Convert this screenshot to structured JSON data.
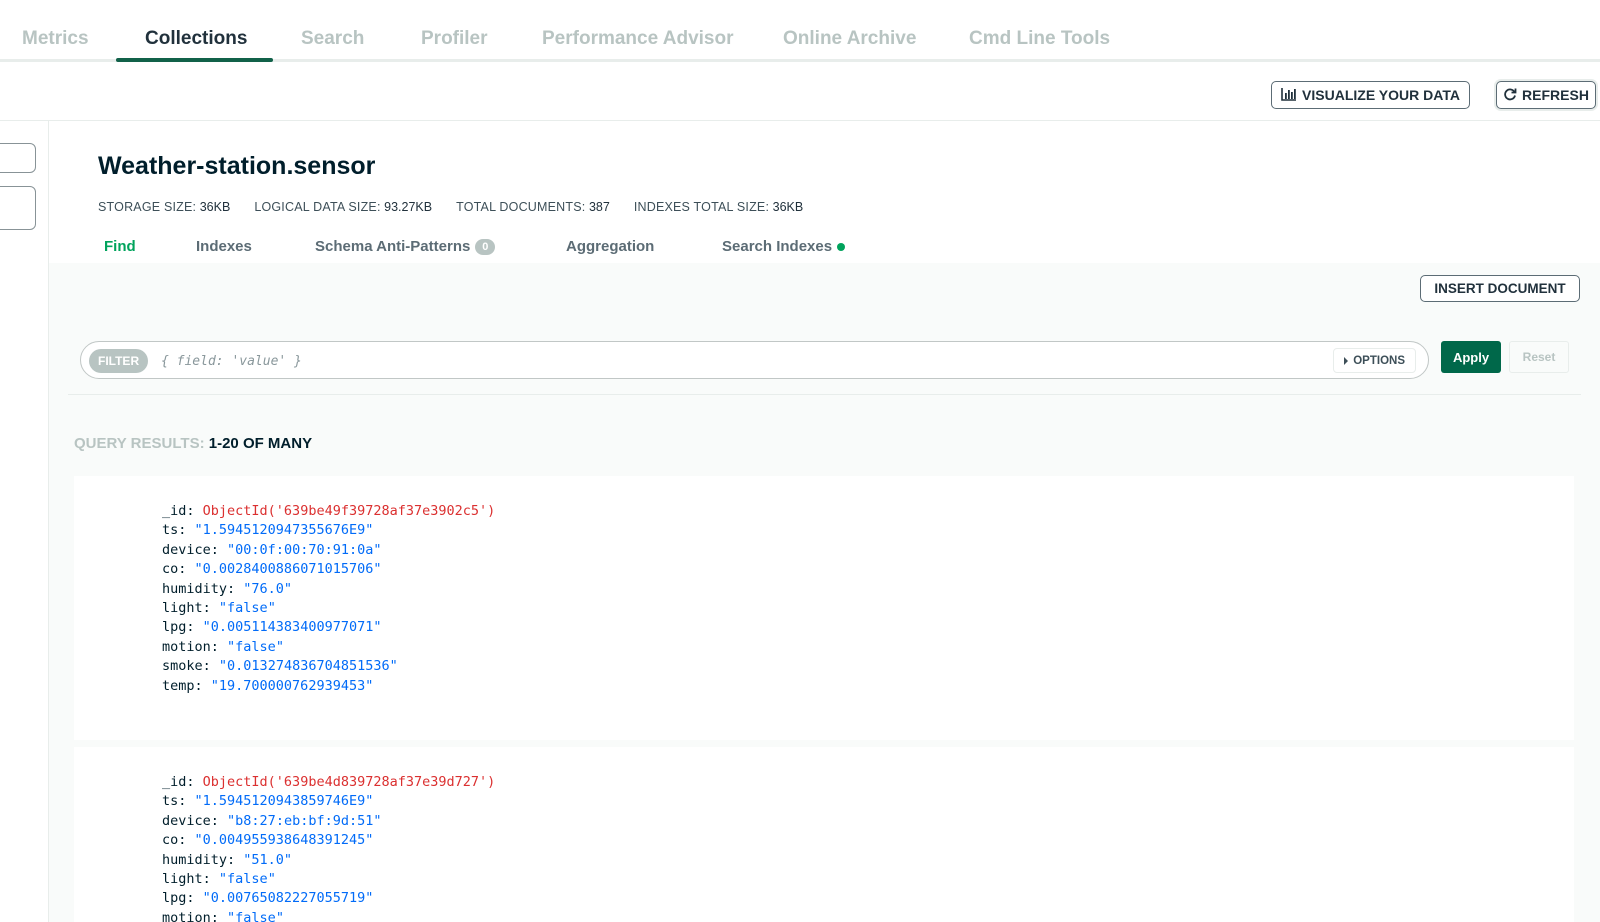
{
  "top_tabs": [
    {
      "label": "Metrics"
    },
    {
      "label": "Collections"
    },
    {
      "label": "Search"
    },
    {
      "label": "Profiler"
    },
    {
      "label": "Performance Advisor"
    },
    {
      "label": "Online Archive"
    },
    {
      "label": "Cmd Line Tools"
    }
  ],
  "active_top_tab": "Collections",
  "header_actions": {
    "visualize_label": "VISUALIZE YOUR DATA",
    "visualize_icon": "bar-chart-icon",
    "refresh_label": "REFRESH",
    "refresh_icon": "refresh-icon"
  },
  "collection": {
    "title": "Weather-station.sensor",
    "stats": [
      {
        "label": "STORAGE SIZE:",
        "value": "36KB"
      },
      {
        "label": "LOGICAL DATA SIZE:",
        "value": "93.27KB"
      },
      {
        "label": "TOTAL DOCUMENTS:",
        "value": "387"
      },
      {
        "label": "INDEXES TOTAL SIZE:",
        "value": "36KB"
      }
    ]
  },
  "sub_tabs": [
    {
      "label": "Find"
    },
    {
      "label": "Indexes"
    },
    {
      "label": "Schema Anti-Patterns",
      "badge": "0"
    },
    {
      "label": "Aggregation"
    },
    {
      "label": "Search Indexes"
    }
  ],
  "active_sub_tab": "Find",
  "insert_document_label": "INSERT DOCUMENT",
  "filter": {
    "pill_label": "FILTER",
    "placeholder": "{ field: 'value' }",
    "options_label": "OPTIONS",
    "apply_label": "Apply",
    "reset_label": "Reset"
  },
  "results": {
    "prefix": "QUERY RESULTS:",
    "range": "1-20 OF MANY"
  },
  "documents": [
    {
      "fields": [
        {
          "key": "_id:",
          "value": "ObjectId('639be49f39728af37e3902c5')"
        },
        {
          "key": "ts:",
          "value": "\"1.5945120947355676E9\""
        },
        {
          "key": "device:",
          "value": "\"00:0f:00:70:91:0a\""
        },
        {
          "key": "co:",
          "value": "\"0.0028400886071015706\""
        },
        {
          "key": "humidity:",
          "value": "\"76.0\""
        },
        {
          "key": "light:",
          "value": "\"false\""
        },
        {
          "key": "lpg:",
          "value": "\"0.005114383400977071\""
        },
        {
          "key": "motion:",
          "value": "\"false\""
        },
        {
          "key": "smoke:",
          "value": "\"0.013274836704851536\""
        },
        {
          "key": "temp:",
          "value": "\"19.700000762939453\""
        }
      ]
    },
    {
      "fields": [
        {
          "key": "_id:",
          "value": "ObjectId('639be4d839728af37e39d727')"
        },
        {
          "key": "ts:",
          "value": "\"1.5945120943859746E9\""
        },
        {
          "key": "device:",
          "value": "\"b8:27:eb:bf:9d:51\""
        },
        {
          "key": "co:",
          "value": "\"0.004955938648391245\""
        },
        {
          "key": "humidity:",
          "value": "\"51.0\""
        },
        {
          "key": "light:",
          "value": "\"false\""
        },
        {
          "key": "lpg:",
          "value": "\"0.00765082227055719\""
        },
        {
          "key": "motion:",
          "value": "\"false\""
        }
      ]
    }
  ],
  "colors": {
    "accent_green": "#00a35c",
    "apply_green": "#00684a",
    "tab_underline": "#116149",
    "object_id_red": "#db3030",
    "value_blue": "#016bf8"
  }
}
